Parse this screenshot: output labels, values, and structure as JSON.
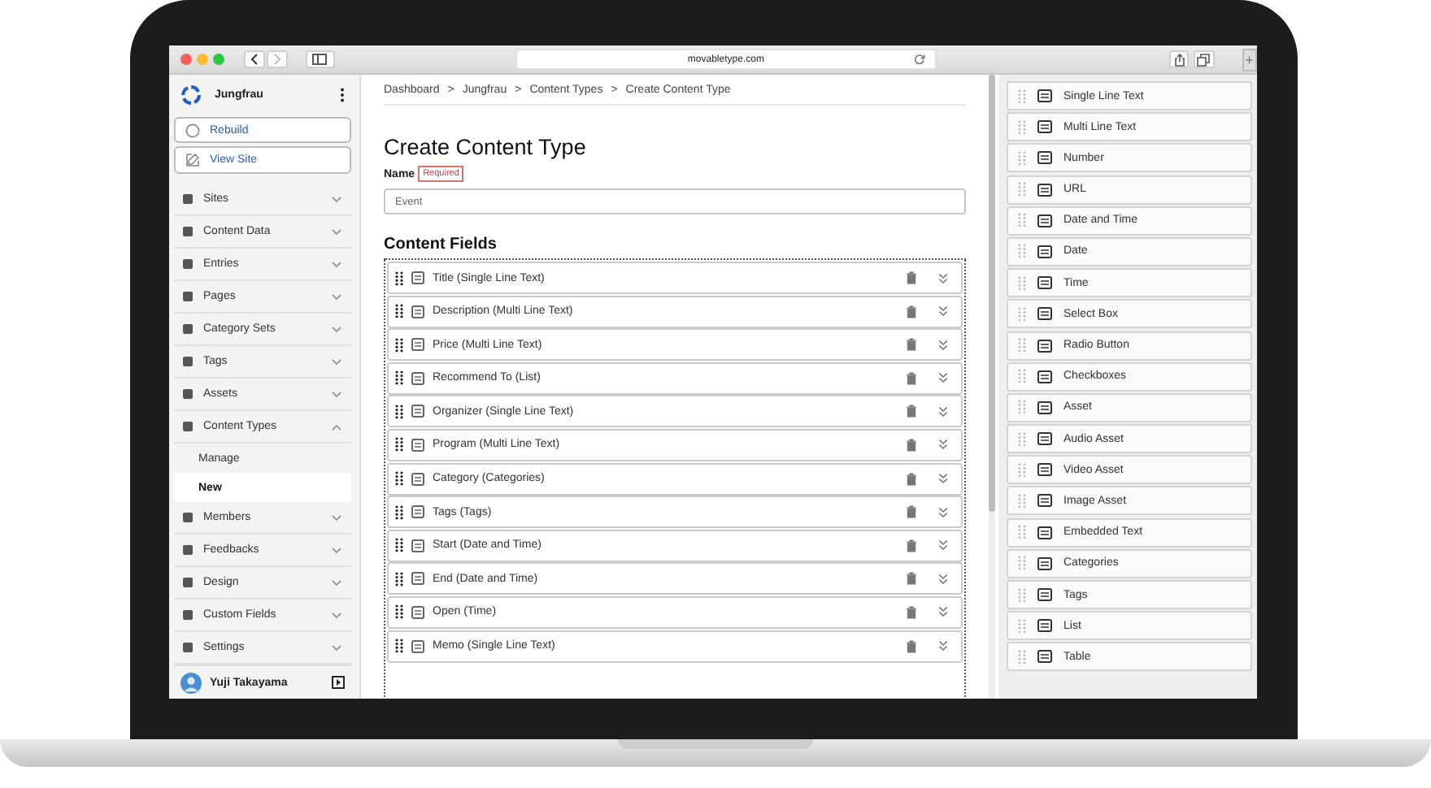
{
  "browser": {
    "url": "movabletype.com",
    "new_tab_label": "+"
  },
  "sidebar": {
    "site_name": "Jungfrau",
    "actions": [
      "Rebuild",
      "View Site"
    ],
    "menu": [
      {
        "label": "Sites",
        "expanded": false
      },
      {
        "label": "Content Data",
        "expanded": false
      },
      {
        "label": "Entries",
        "expanded": false
      },
      {
        "label": "Pages",
        "expanded": false
      },
      {
        "label": "Category Sets",
        "expanded": false
      },
      {
        "label": "Tags",
        "expanded": false
      },
      {
        "label": "Assets",
        "expanded": false
      },
      {
        "label": "Content Types",
        "expanded": true,
        "children": [
          {
            "label": "Manage",
            "selected": false
          },
          {
            "label": "New",
            "selected": true
          }
        ]
      },
      {
        "label": "Members",
        "expanded": false
      },
      {
        "label": "Feedbacks",
        "expanded": false
      },
      {
        "label": "Design",
        "expanded": false
      },
      {
        "label": "Custom Fields",
        "expanded": false
      },
      {
        "label": "Settings",
        "expanded": false
      }
    ],
    "user": "Yuji Takayama"
  },
  "breadcrumb": {
    "items": [
      "Dashboard",
      "Jungfrau",
      "Content Types",
      "Create Content Type"
    ],
    "separator": ">"
  },
  "page_title": "Create Content Type",
  "name_field": {
    "label": "Name",
    "badge": "Required",
    "value": "Event"
  },
  "content_fields": {
    "title": "Content Fields",
    "rows": [
      "Title (Single Line Text)",
      "Description (Multi Line Text)",
      "Price (Multi Line Text)",
      "Recommend To (List)",
      "Organizer (Single Line Text)",
      "Program (Multi Line Text)",
      "Category (Categories)",
      "Tags (Tags)",
      "Start (Date and Time)",
      "End (Date and Time)",
      "Open (Time)",
      "Memo (Single Line Text)"
    ]
  },
  "field_types": [
    "Single Line Text",
    "Multi Line Text",
    "Number",
    "URL",
    "Date and Time",
    "Date",
    "Time",
    "Select Box",
    "Radio Button",
    "Checkboxes",
    "Asset",
    "Audio Asset",
    "Video Asset",
    "Image Asset",
    "Embedded Text",
    "Categories",
    "Tags",
    "List",
    "Table"
  ]
}
